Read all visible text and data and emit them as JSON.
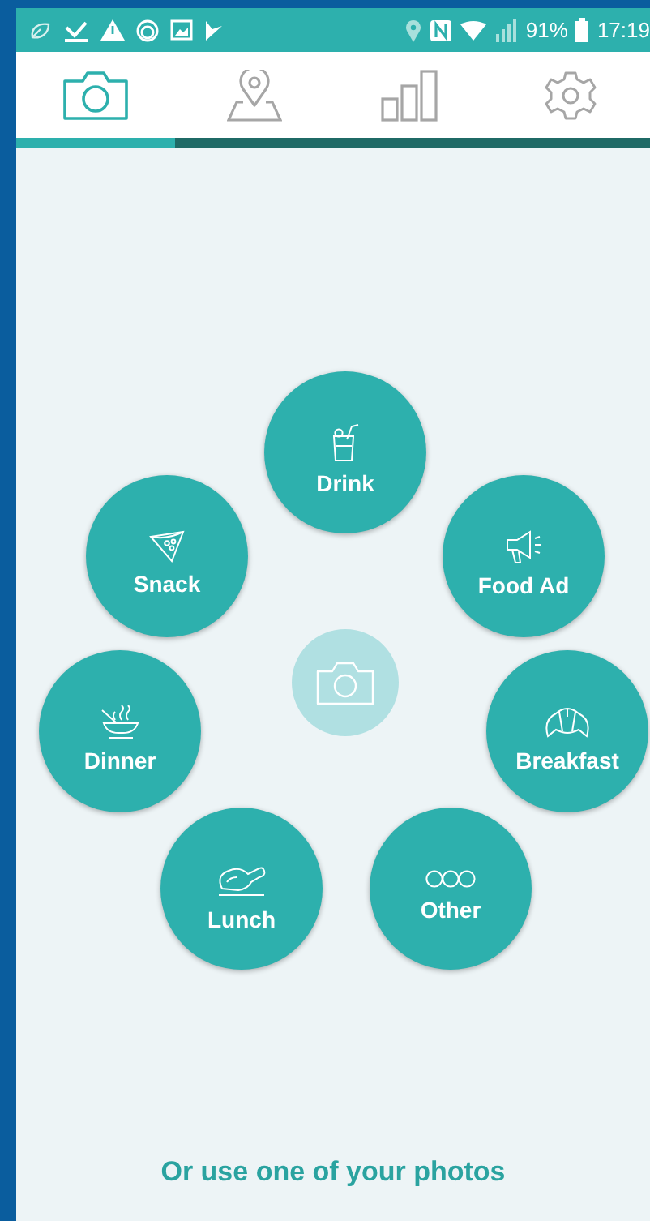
{
  "status_bar": {
    "battery": "91%",
    "time": "17:19"
  },
  "tabs": [
    {
      "kind": "camera",
      "selected": true
    },
    {
      "kind": "map",
      "selected": false
    },
    {
      "kind": "stats",
      "selected": false
    },
    {
      "kind": "settings",
      "selected": false
    }
  ],
  "categories": [
    {
      "label": "Drink",
      "kind": "drink"
    },
    {
      "label": "Snack",
      "kind": "snack"
    },
    {
      "label": "Food Ad",
      "kind": "ad"
    },
    {
      "label": "Dinner",
      "kind": "dinner"
    },
    {
      "label": "Breakfast",
      "kind": "breakfast"
    },
    {
      "label": "Lunch",
      "kind": "lunch"
    },
    {
      "label": "Other",
      "kind": "other"
    }
  ],
  "photos_link": "Or use one of your photos"
}
